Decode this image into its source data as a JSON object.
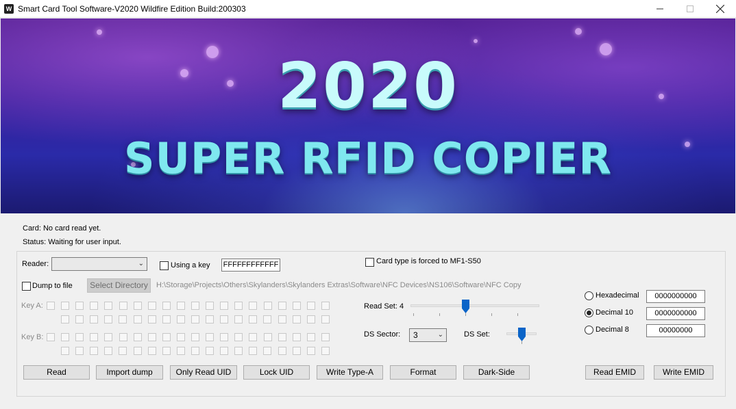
{
  "window": {
    "title": "Smart Card Tool Software-V2020 Wildfire Edition Build:200303",
    "icon_label": "W",
    "minimize_icon": "minimize-icon",
    "maximize_icon": "maximize-icon",
    "close_icon": "close-icon"
  },
  "banner": {
    "year": "2020",
    "subtitle": "SUPER RFID COPIER"
  },
  "status": {
    "card": "Card: No card read yet.",
    "status": "Status: Waiting for user input."
  },
  "reader": {
    "label": "Reader:",
    "value": "",
    "using_key_label": "Using a key",
    "using_key_checked": false,
    "key_value": "FFFFFFFFFFFF",
    "card_type_forced_label": "Card type is forced to MF1-S50",
    "card_type_forced_checked": false
  },
  "dump": {
    "dump_to_file_label": "Dump to file",
    "dump_to_file_checked": false,
    "select_directory_label": "Select Directory",
    "path": "H:\\Storage\\Projects\\Others\\Skylanders\\Skylanders Extras\\Software\\NFC Devices\\NS106\\Software\\NFC Copy"
  },
  "keys": {
    "key_a_label": "Key A:",
    "key_b_label": "Key B:"
  },
  "read_set": {
    "label": "Read Set: 4",
    "value": 4
  },
  "ds": {
    "sector_label": "DS Sector:",
    "sector_value": "3",
    "set_label": "DS Set:"
  },
  "format": {
    "hex_label": "Hexadecimal",
    "hex_value": "0000000000",
    "dec10_label": "Decimal 10",
    "dec10_value": "0000000000",
    "dec8_label": "Decimal 8",
    "dec8_value": "00000000",
    "selected": "Decimal 10"
  },
  "buttons": {
    "read": "Read",
    "import_dump": "Import dump",
    "only_read_uid": "Only Read UID",
    "lock_uid": "Lock UID",
    "write_type_a": "Write Type-A",
    "format": "Format",
    "dark_side": "Dark-Side",
    "read_emid": "Read EMID",
    "write_emid": "Write EMID"
  }
}
